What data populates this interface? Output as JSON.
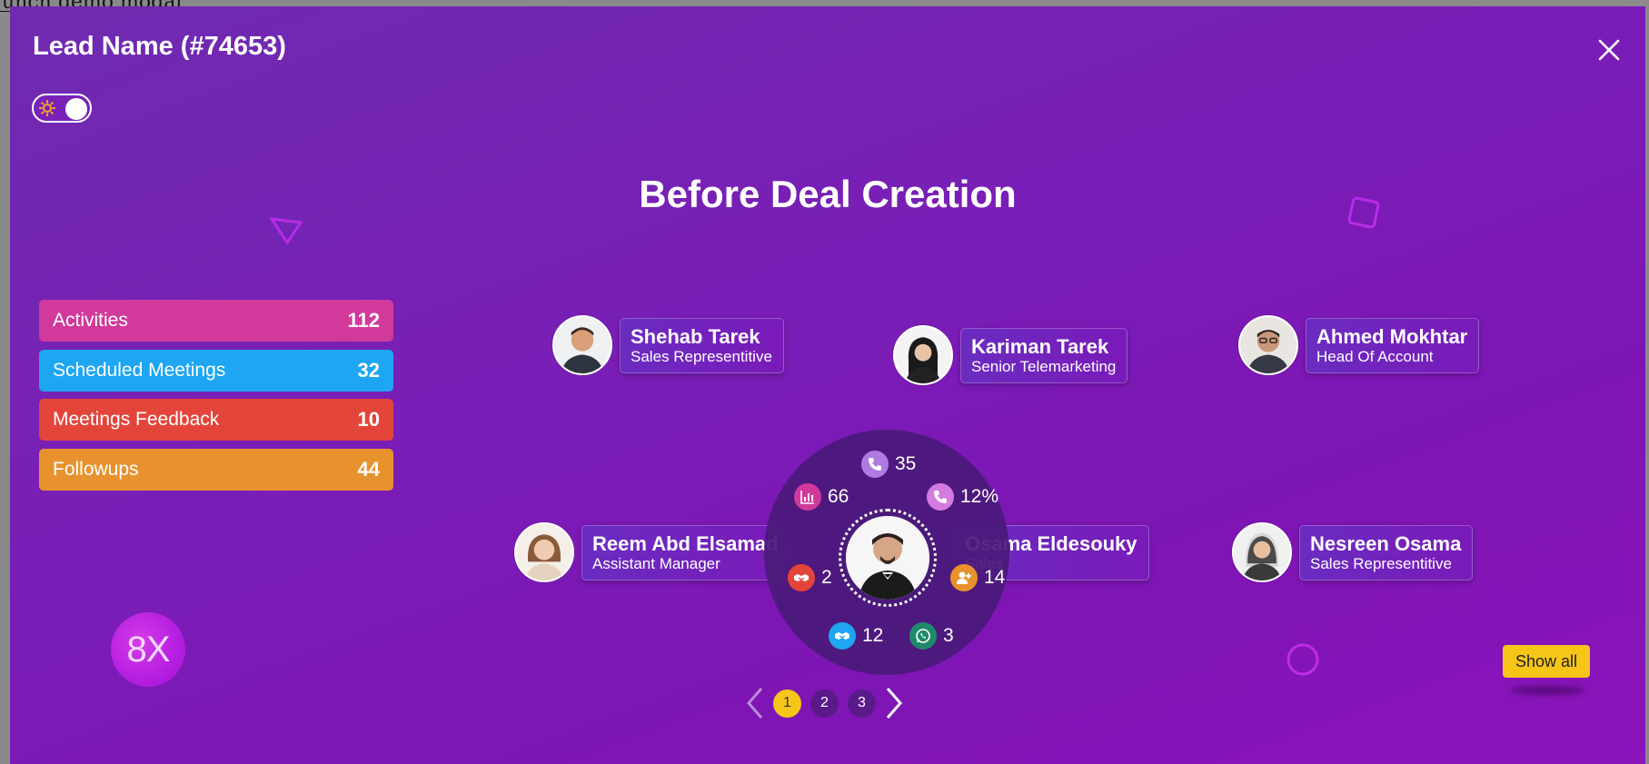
{
  "background": {
    "launch_link": "unch demo modal"
  },
  "modal": {
    "title": "Lead Name (#74653)",
    "section_title": "Before Deal Creation"
  },
  "stats": [
    {
      "label": "Activities",
      "count": "112",
      "color": "#d13a9a"
    },
    {
      "label": "Scheduled Meetings",
      "count": "32",
      "color": "#1ea6f2"
    },
    {
      "label": "Meetings Feedback",
      "count": "10",
      "color": "#e4453a"
    },
    {
      "label": "Followups",
      "count": "44",
      "color": "#e8922e"
    }
  ],
  "logo": {
    "text": "8X"
  },
  "team": [
    {
      "name": "Shehab Tarek",
      "role": "Sales Representitive"
    },
    {
      "name": "Kariman Tarek",
      "role": "Senior Telemarketing"
    },
    {
      "name": "Ahmed Mokhtar",
      "role": "Head Of Account"
    },
    {
      "name": "Reem Abd Elsamad",
      "role": "Assistant Manager"
    },
    {
      "name": "Osama Eldesouky",
      "role": "Sales"
    },
    {
      "name": "Nesreen Osama",
      "role": "Sales Representitive"
    }
  ],
  "hub": {
    "stats": [
      {
        "icon": "phone-icon",
        "value": "35",
        "color": "#b07be0"
      },
      {
        "icon": "bar-chart-icon",
        "value": "66",
        "color": "#d13a9a"
      },
      {
        "icon": "phone-icon",
        "value": "12%",
        "color": "#d47ae0"
      },
      {
        "icon": "handshake-icon",
        "value": "2",
        "color": "#e4453a"
      },
      {
        "icon": "user-plus-icon",
        "value": "14",
        "color": "#e8922e"
      },
      {
        "icon": "handshake-icon",
        "value": "12",
        "color": "#1ea6f2"
      },
      {
        "icon": "whatsapp-icon",
        "value": "3",
        "color": "#1f8a6b"
      }
    ]
  },
  "pagination": {
    "pages": [
      "1",
      "2",
      "3"
    ],
    "active": "1"
  },
  "show_all_label": "Show all",
  "colors": {
    "accent": "#f5c518",
    "modal_bg": "#7a1db7"
  }
}
